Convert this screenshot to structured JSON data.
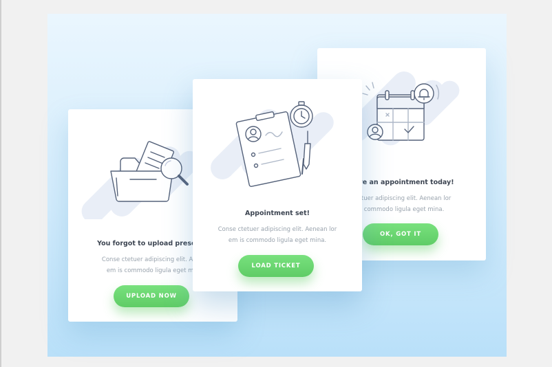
{
  "colors": {
    "background_top": "#eaf6fe",
    "background_bottom": "#b9e0f9",
    "card": "#ffffff",
    "accent_green": "#6ad66f",
    "title_text": "#3d4552",
    "body_text": "#99a3ad",
    "icon_stroke": "#55627a",
    "icon_blob": "#e9eef7"
  },
  "cards": [
    {
      "illustration": "folder-magnifier-icon",
      "title": "You forgot to upload prescript",
      "body_lines": [
        "Conse ctetuer adipiscing elit. Aene",
        "em is commodo ligula eget min"
      ],
      "button_label": "UPLOAD NOW"
    },
    {
      "illustration": "clipboard-stopwatch-pen-icon",
      "title": "Appointment set!",
      "body_lines": [
        "Conse ctetuer adipiscing elit. Aenean lor",
        "em is commodo ligula eget mina."
      ],
      "button_label": "LOAD TICKET"
    },
    {
      "illustration": "calendar-bell-icon",
      "title": "have an appointment today!",
      "body_lines": [
        "ctetuer adipiscing elit. Aenean lor",
        "s commodo ligula eget mina."
      ],
      "button_label": "OK, GOT IT"
    }
  ]
}
